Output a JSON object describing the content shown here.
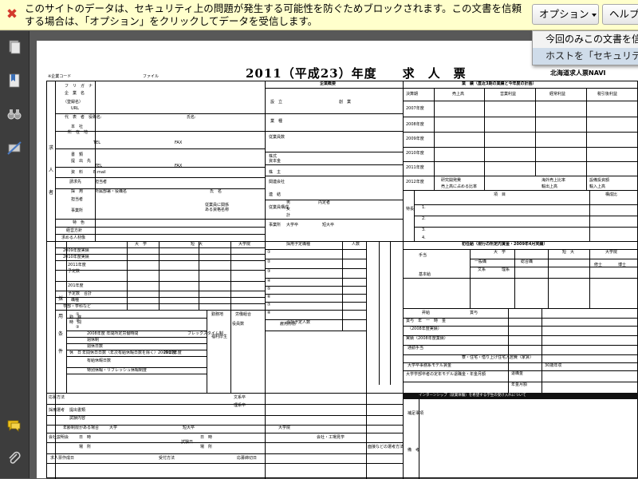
{
  "security_bar": {
    "message": "このサイトのデータは、セキュリティ上の問題が発生する可能性を防ぐためブロックされます。この文書を信頼する場合は、「オプション」をクリックしてデータを受信します。",
    "options_button": "オプション",
    "help_button": "ヘルプ"
  },
  "options_menu": {
    "items": [
      "今回のみこの文書を信",
      "ホストを「セキュリテ"
    ]
  },
  "sidebar": {
    "icons": [
      "pages-icon",
      "bookmarks-icon",
      "search-binoculars-icon",
      "signatures-icon",
      "comments-icon",
      "attachments-icon"
    ]
  },
  "document": {
    "company_code_label": "※企業コード",
    "file_label": "ファイル",
    "title": "2011（平成23）年度　　求　人　票",
    "site_name": "北海道求人票NAVI",
    "left_labels": {
      "kyujinsha": [
        "求",
        "人",
        "者"
      ],
      "saiyou": [
        "採",
        "用",
        "条",
        "件"
      ]
    },
    "company_fields": [
      "フ　リ　ガ　ナ",
      "企　業　名",
      "（登録名）",
      "URL",
      "代　表　者　役職名:",
      "氏名:",
      "本　社",
      "所　在　地",
      "TEL",
      "FAX",
      "書　類",
      "提　出　先",
      "TEL",
      "FAX",
      "資　料",
      "E-mail",
      "請求先",
      "担当者",
      "採　用",
      "所属部署・役職名",
      "氏　名",
      "担当者",
      "事業所",
      "従業員に関係ある資格名称",
      "特　色",
      "経営方針",
      "求める人材像"
    ],
    "overview": {
      "header": "企業概要",
      "labels": [
        "設　立",
        "創　業",
        "業　種",
        "従業員数",
        "株式",
        "資本金",
        "株　主",
        "関連会社",
        "主要取引先",
        "連　結",
        "子会社",
        "従業員構成",
        "男",
        "女",
        "計",
        "平均年齢",
        "内定者",
        "大学卒",
        "短大卒",
        "全国",
        "事業所",
        "支社",
        "工場"
      ]
    },
    "performance": {
      "header": "業　績（直近3期の業績と今年度の計画）",
      "columns": [
        "決算期",
        "売上高",
        "営業利益",
        "経常利益",
        "税引後利益"
      ],
      "years": [
        "2007年度",
        "2008年度",
        "2009年度",
        "2010年度",
        "2011年度",
        "2012年度"
      ],
      "extra": [
        "研究開発費",
        "海外売上比率",
        "設備投資額",
        "売上高に占める比率",
        "輸出上高",
        "輸入上高"
      ]
    },
    "features": {
      "label": "特長",
      "header": [
        "項　目",
        "構成比"
      ],
      "items": [
        "1.",
        "2.",
        "3.",
        "4."
      ]
    },
    "recruit_table": {
      "header": [
        "大　学",
        "短　大",
        "大学院"
      ],
      "rows": [
        "2009年度実績",
        "2010年度実績",
        "2011年度",
        "予定数",
        "201年度",
        "予定数　合計",
        "職種",
        "学部・学科など"
      ],
      "units": [
        "人",
        "男",
        "女",
        "人"
      ],
      "job_header": [
        "採用予定職種",
        "人数"
      ],
      "job_rows": [
        "①",
        "②",
        "③",
        "④",
        "⑤",
        "⑥",
        "⑦",
        "⑧",
        "合計予定人数"
      ]
    },
    "salary": {
      "header": "初任給（現行の所定内賃金・2009年4月実績）",
      "cols": [
        "大　学",
        "短　大",
        "大学院"
      ],
      "sub": [
        "一般職",
        "総合職",
        "文系",
        "理系",
        "修士",
        "博士"
      ],
      "labels": [
        "基本給",
        "手当",
        "昇給",
        "賞与",
        "賞与　年　一　時　金",
        "（2008年度実績）",
        "実績（2008年度業績）",
        "通勤手当",
        "寮・住宅・借り上げ住宅入居費（家賃）",
        "大学卒事務系モデル賃金",
        "大学学部卒者の定年モデル退職金・年金月額",
        "退職金",
        "年金月額",
        "30歳年収"
      ],
      "footer": "インターンシップ（就業体験）を希望する学生の受け入れについて"
    },
    "conditions": {
      "labels": [
        "勤　務",
        "時　間",
        "①",
        "②",
        "③",
        "2008年度 年間所定労働時間",
        "フレックスタイム制",
        "週休制",
        "休　日",
        "週休日数",
        "年間休日日数（年次有給休暇日数を除く）2009年度",
        "2010年度",
        "有給休暇日数",
        "特別休暇・リフレッシュ休暇制度",
        "勤務地",
        "初任地",
        "転勤",
        "福利厚生",
        "労働組合",
        "労働組合",
        "保険",
        "制度",
        "雇用形態",
        "退職金制度",
        "役員数",
        "正社員",
        "契約",
        "年",
        "月",
        "日",
        "現在",
        "文系卒",
        "理系卒"
      ]
    },
    "bottom": {
      "labels": [
        "応募方法",
        "採用選考",
        "提出書類",
        "試験内容",
        "年齢制限がある場合",
        "大学",
        "短大卒",
        "大学院",
        "会社説明会",
        "日　時",
        "場　所",
        "試験日",
        "日　時",
        "場　所",
        "会社・工場見学",
        "求人票作成日",
        "受付方法",
        "応募締切日",
        "補足事項",
        "備　考",
        "面接などの選考方法"
      ]
    }
  }
}
